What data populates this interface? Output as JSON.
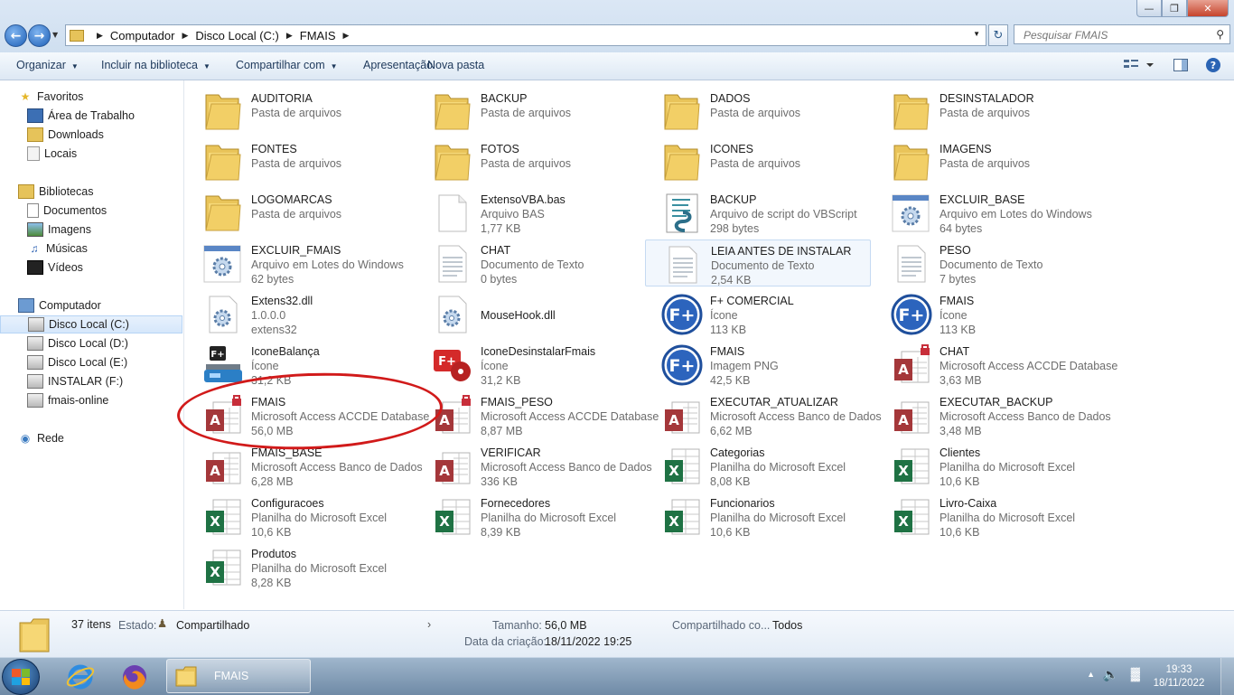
{
  "address": {
    "crumbs": [
      "Computador",
      "Disco Local (C:)",
      "FMAIS"
    ]
  },
  "search": {
    "placeholder": "Pesquisar FMAIS"
  },
  "toolbar": {
    "organize": "Organizar",
    "include_library": "Incluir na biblioteca",
    "share_with": "Compartilhar com",
    "slideshow": "Apresentação",
    "new_folder": "Nova pasta"
  },
  "nav": {
    "favorites": "Favoritos",
    "desktop": "Área de Trabalho",
    "downloads": "Downloads",
    "places": "Locais",
    "libraries": "Bibliotecas",
    "documents": "Documentos",
    "images": "Imagens",
    "music": "Músicas",
    "videos": "Vídeos",
    "computer": "Computador",
    "drive_c": "Disco Local (C:)",
    "drive_d": "Disco Local (D:)",
    "drive_e": "Disco Local (E:)",
    "drive_f": "INSTALAR (F:)",
    "fmais_online": "fmais-online",
    "network": "Rede"
  },
  "files": [
    {
      "name": "AUDITORIA",
      "type": "Pasta de arquivos",
      "size": "",
      "icon": "folder"
    },
    {
      "name": "BACKUP",
      "type": "Pasta de arquivos",
      "size": "",
      "icon": "folder"
    },
    {
      "name": "DADOS",
      "type": "Pasta de arquivos",
      "size": "",
      "icon": "folder"
    },
    {
      "name": "DESINSTALADOR",
      "type": "Pasta de arquivos",
      "size": "",
      "icon": "folder"
    },
    {
      "name": "FONTES",
      "type": "Pasta de arquivos",
      "size": "",
      "icon": "folder"
    },
    {
      "name": "FOTOS",
      "type": "Pasta de arquivos",
      "size": "",
      "icon": "folder"
    },
    {
      "name": "ICONES",
      "type": "Pasta de arquivos",
      "size": "",
      "icon": "folder"
    },
    {
      "name": "IMAGENS",
      "type": "Pasta de arquivos",
      "size": "",
      "icon": "folder"
    },
    {
      "name": "LOGOMARCAS",
      "type": "Pasta de arquivos",
      "size": "",
      "icon": "folder"
    },
    {
      "name": "ExtensoVBA.bas",
      "type": "Arquivo BAS",
      "size": "1,77 KB",
      "icon": "blank-file"
    },
    {
      "name": "BACKUP",
      "type": "Arquivo de script do VBScript",
      "size": "298 bytes",
      "icon": "vbscript"
    },
    {
      "name": "EXCLUIR_BASE",
      "type": "Arquivo em Lotes do Windows",
      "size": "64 bytes",
      "icon": "batch-gear"
    },
    {
      "name": "EXCLUIR_FMAIS",
      "type": "Arquivo em Lotes do Windows",
      "size": "62 bytes",
      "icon": "batch-gear"
    },
    {
      "name": "CHAT",
      "type": "Documento de Texto",
      "size": "0 bytes",
      "icon": "text-file"
    },
    {
      "name": "LEIA ANTES DE INSTALAR",
      "type": "Documento de Texto",
      "size": "2,54 KB",
      "icon": "text-file"
    },
    {
      "name": "PESO",
      "type": "Documento de Texto",
      "size": "7 bytes",
      "icon": "text-file"
    },
    {
      "name": "Extens32.dll",
      "type": "1.0.0.0",
      "size": "extens32",
      "icon": "dll-gear"
    },
    {
      "name": "MouseHook.dll",
      "type": "",
      "size": "",
      "icon": "dll-gear"
    },
    {
      "name": "F+ COMERCIAL",
      "type": "Ícone",
      "size": "113 KB",
      "icon": "fplus-logo"
    },
    {
      "name": "FMAIS",
      "type": "Ícone",
      "size": "113 KB",
      "icon": "fplus-logo"
    },
    {
      "name": "IconeBalança",
      "type": "Ícone",
      "size": "31,2 KB",
      "icon": "scale-icon"
    },
    {
      "name": "IconeDesinstalarFmais",
      "type": "Ícone",
      "size": "31,2 KB",
      "icon": "uninstall-icon"
    },
    {
      "name": "FMAIS",
      "type": "Imagem PNG",
      "size": "42,5 KB",
      "icon": "fplus-logo"
    },
    {
      "name": "CHAT",
      "type": "Microsoft Access ACCDE Database",
      "size": "3,63 MB",
      "icon": "access-locked"
    },
    {
      "name": "FMAIS",
      "type": "Microsoft Access ACCDE Database",
      "size": "56,0 MB",
      "icon": "access-locked"
    },
    {
      "name": "FMAIS_PESO",
      "type": "Microsoft Access ACCDE Database",
      "size": "8,87 MB",
      "icon": "access-locked"
    },
    {
      "name": "EXECUTAR_ATUALIZAR",
      "type": "Microsoft Access Banco de Dados",
      "size": "6,62 MB",
      "icon": "access"
    },
    {
      "name": "EXECUTAR_BACKUP",
      "type": "Microsoft Access Banco de Dados",
      "size": "3,48 MB",
      "icon": "access"
    },
    {
      "name": "FMAIS_BASE",
      "type": "Microsoft Access Banco de Dados",
      "size": "6,28 MB",
      "icon": "access"
    },
    {
      "name": "VERIFICAR",
      "type": "Microsoft Access Banco de Dados",
      "size": "336 KB",
      "icon": "access"
    },
    {
      "name": "Categorias",
      "type": "Planilha do Microsoft Excel",
      "size": "8,08 KB",
      "icon": "excel"
    },
    {
      "name": "Clientes",
      "type": "Planilha do Microsoft Excel",
      "size": "10,6 KB",
      "icon": "excel"
    },
    {
      "name": "Configuracoes",
      "type": "Planilha do Microsoft Excel",
      "size": "10,6 KB",
      "icon": "excel"
    },
    {
      "name": "Fornecedores",
      "type": "Planilha do Microsoft Excel",
      "size": "8,39 KB",
      "icon": "excel"
    },
    {
      "name": "Funcionarios",
      "type": "Planilha do Microsoft Excel",
      "size": "10,6 KB",
      "icon": "excel"
    },
    {
      "name": "Livro-Caixa",
      "type": "Planilha do Microsoft Excel",
      "size": "10,6 KB",
      "icon": "excel"
    },
    {
      "name": "Produtos",
      "type": "Planilha do Microsoft Excel",
      "size": "8,28 KB",
      "icon": "excel"
    }
  ],
  "details": {
    "count": "37 itens",
    "state_label": "Estado:",
    "state_value": "Compartilhado",
    "size_label": "Tamanho:",
    "size_value": "56,0 MB",
    "created_label": "Data da criação:",
    "created_value": "18/11/2022 19:25",
    "shared_label": "Compartilhado co...",
    "shared_value": "Todos"
  },
  "taskbar": {
    "window_title": "FMAIS",
    "time": "19:33",
    "date": "18/11/2022"
  }
}
